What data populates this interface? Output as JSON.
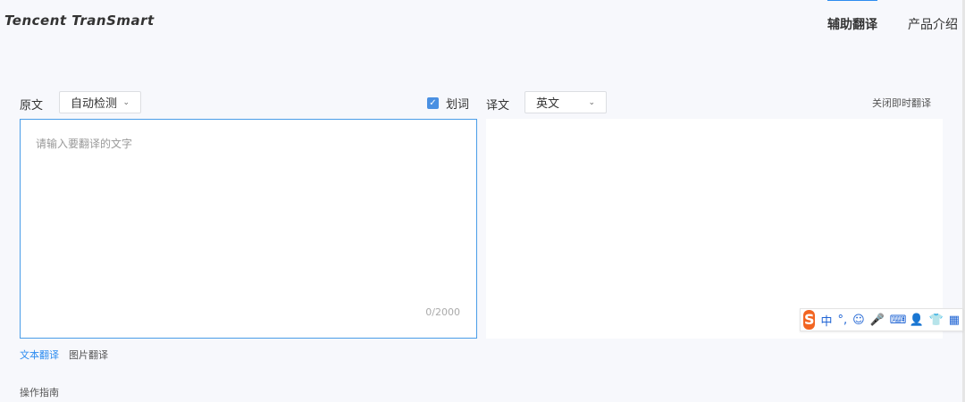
{
  "header": {
    "logo": "Tencent TranSmart",
    "nav": [
      {
        "label": "辅助翻译",
        "active": true
      },
      {
        "label": "产品介绍",
        "active": false
      }
    ]
  },
  "source": {
    "label": "原文",
    "language": "自动检测",
    "placeholder": "请输入要翻译的文字",
    "value": "",
    "counter": "0/2000"
  },
  "word_select": {
    "label": "划词",
    "checked": true
  },
  "target": {
    "label": "译文",
    "language": "英文",
    "close_instant": "关闭即时翻译"
  },
  "modes": [
    {
      "label": "文本翻译",
      "active": true
    },
    {
      "label": "图片翻译",
      "active": false
    }
  ],
  "guide": "操作指南",
  "ime": {
    "logo": "S",
    "items": [
      {
        "icon": "chinese-mode-icon",
        "glyph": "中"
      },
      {
        "icon": "punctuation-icon",
        "glyph": "°,"
      },
      {
        "icon": "emoji-icon",
        "glyph": "☺"
      },
      {
        "icon": "microphone-icon",
        "glyph": "🎤"
      },
      {
        "icon": "keyboard-icon",
        "glyph": "⌨"
      },
      {
        "icon": "user-icon",
        "glyph": "👤"
      },
      {
        "icon": "skin-shirt-icon",
        "glyph": "👕"
      },
      {
        "icon": "toolbox-grid-icon",
        "glyph": "▦"
      }
    ]
  },
  "colors": {
    "accent": "#2d8cf0",
    "ime_orange": "#f26522"
  }
}
